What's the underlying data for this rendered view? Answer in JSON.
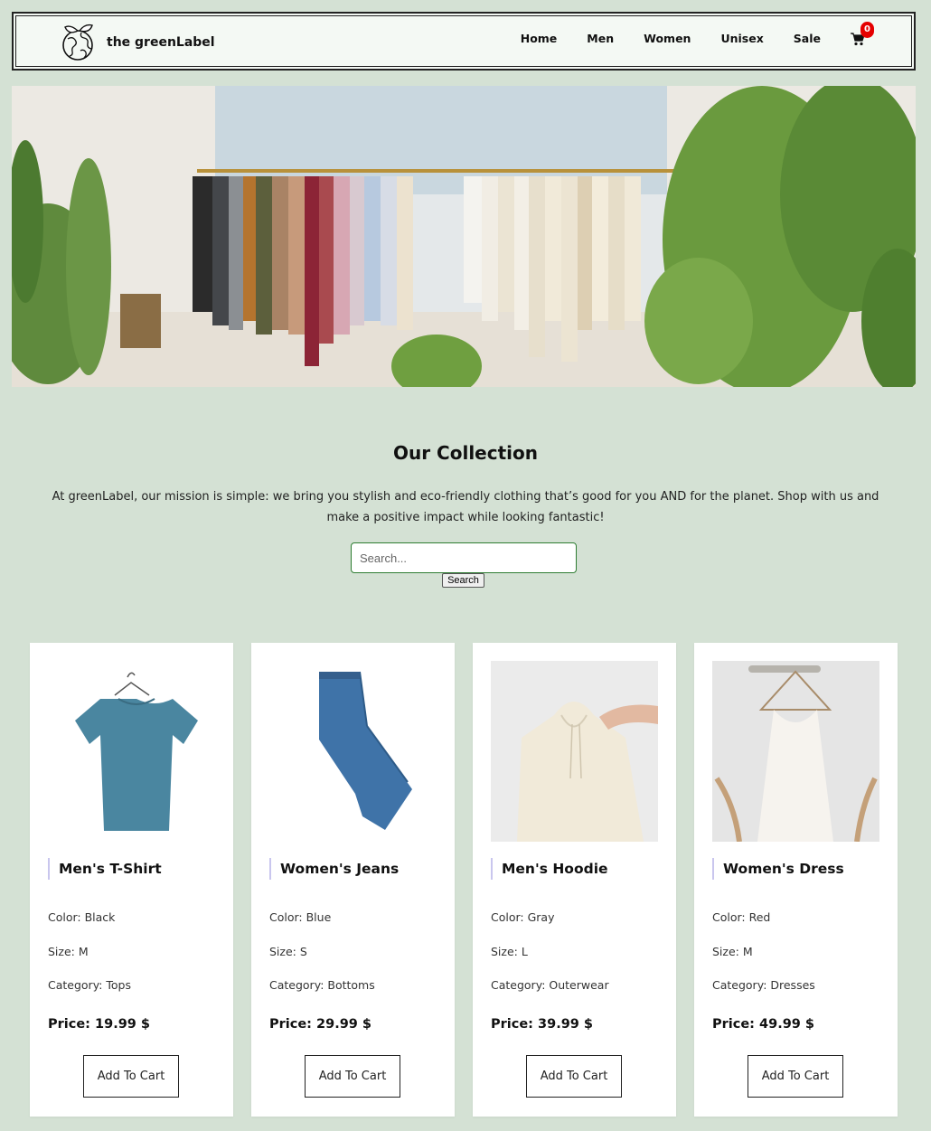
{
  "brand": {
    "name": "the greenLabel"
  },
  "nav": {
    "links": [
      "Home",
      "Men",
      "Women",
      "Unisex",
      "Sale"
    ],
    "cart_count": "0"
  },
  "collection": {
    "title": "Our Collection",
    "mission": "At greenLabel, our mission is simple: we bring you stylish and eco-friendly clothing that’s good for you AND for the planet. Shop with us and make a positive impact while looking fantastic!",
    "search_placeholder": "Search...",
    "search_button": "Search"
  },
  "products": [
    {
      "name": "Men's T-Shirt",
      "color": "Color: Black",
      "size": "Size: M",
      "category": "Category: Tops",
      "price": "Price: 19.99 $",
      "button": "Add To Cart"
    },
    {
      "name": "Women's Jeans",
      "color": "Color: Blue",
      "size": "Size: S",
      "category": "Category: Bottoms",
      "price": "Price: 29.99 $",
      "button": "Add To Cart"
    },
    {
      "name": "Men's Hoodie",
      "color": "Color: Gray",
      "size": "Size: L",
      "category": "Category: Outerwear",
      "price": "Price: 39.99 $",
      "button": "Add To Cart"
    },
    {
      "name": "Women's Dress",
      "color": "Color: Red",
      "size": "Size: M",
      "category": "Category: Dresses",
      "price": "Price: 49.99 $",
      "button": "Add To Cart"
    }
  ]
}
